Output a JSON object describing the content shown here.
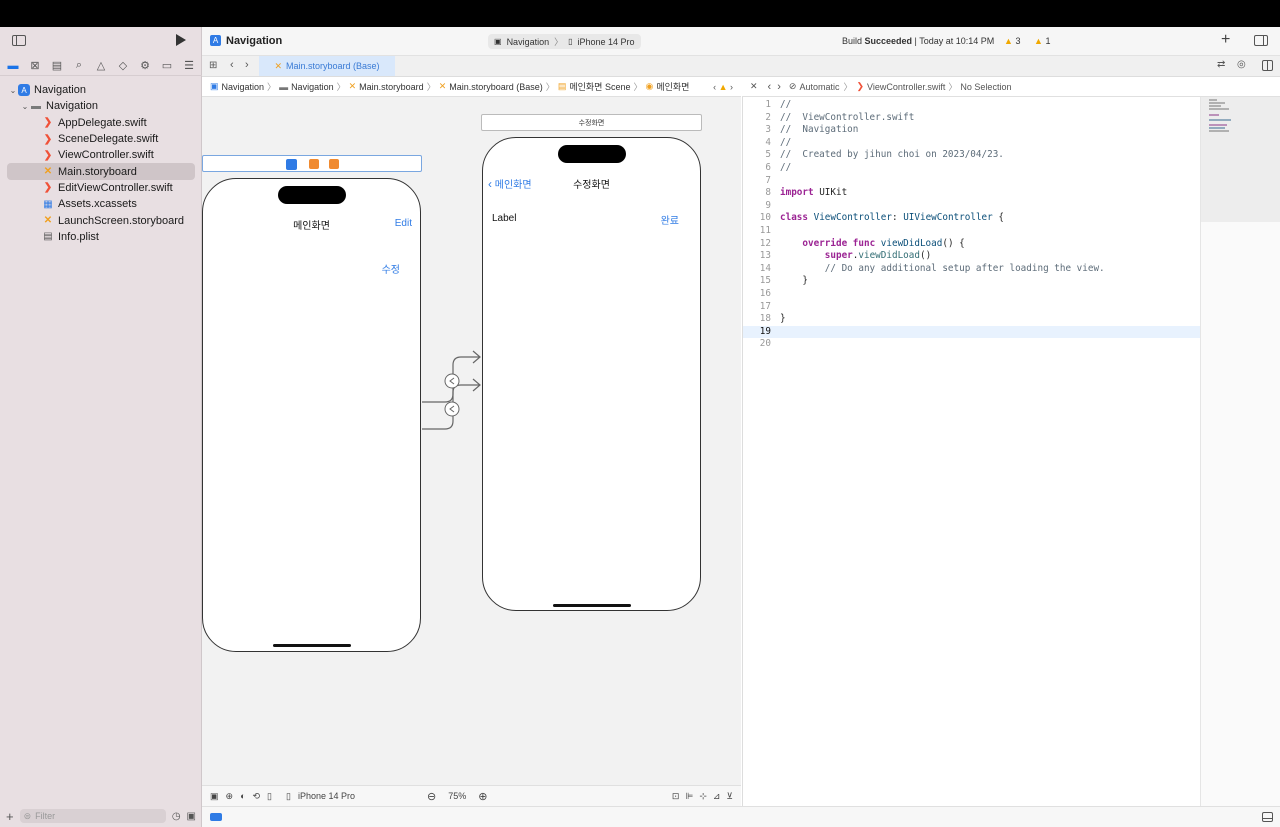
{
  "titlebar": {
    "project_name": "Navigation",
    "scheme": "Navigation",
    "device": "iPhone 14 Pro",
    "status_prefix": "Build ",
    "status_bold": "Succeeded",
    "status_time": " | Today at 10:14 PM",
    "warning_count": "3",
    "issue_count": "1"
  },
  "tab": {
    "label": "Main.storyboard (Base)"
  },
  "navigator": {
    "items": [
      {
        "label": "Navigation",
        "icon": "app-icon",
        "indent": 0,
        "disclosure": true
      },
      {
        "label": "Navigation",
        "icon": "folder-icon",
        "indent": 1,
        "disclosure": true
      },
      {
        "label": "AppDelegate.swift",
        "icon": "swift-icon",
        "indent": 2
      },
      {
        "label": "SceneDelegate.swift",
        "icon": "swift-icon",
        "indent": 2
      },
      {
        "label": "ViewController.swift",
        "icon": "swift-icon",
        "indent": 2
      },
      {
        "label": "Main.storyboard",
        "icon": "storyboard-icon",
        "indent": 2,
        "selected": true
      },
      {
        "label": "EditViewController.swift",
        "icon": "swift-icon",
        "indent": 2
      },
      {
        "label": "Assets.xcassets",
        "icon": "assets-icon",
        "indent": 2
      },
      {
        "label": "LaunchScreen.storyboard",
        "icon": "storyboard-icon",
        "indent": 2
      },
      {
        "label": "Info.plist",
        "icon": "plist-icon",
        "indent": 2
      }
    ],
    "filter_placeholder": "Filter"
  },
  "jumpbar_left": {
    "crumbs": [
      "Navigation",
      "Navigation",
      "Main.storyboard",
      "Main.storyboard (Base)",
      "메인화면 Scene",
      "메인화면"
    ]
  },
  "storyboard": {
    "main_scene": {
      "title": "메인화면",
      "right_button": "Edit",
      "edit_link": "수정"
    },
    "edit_scene": {
      "header": "수정화면",
      "title": "수정화면",
      "back_label": "메인화면",
      "label_text": "Label",
      "done_button": "완료"
    }
  },
  "canvas_bottom": {
    "device": "iPhone 14 Pro",
    "zoom": "75%"
  },
  "jumpbar_right": {
    "mode": "Automatic",
    "file": "ViewController.swift",
    "selection": "No Selection"
  },
  "code": {
    "current_line": 19,
    "lines": [
      [
        [
          "cm",
          "//"
        ]
      ],
      [
        [
          "cm",
          "//  ViewController.swift"
        ]
      ],
      [
        [
          "cm",
          "//  Navigation"
        ]
      ],
      [
        [
          "cm",
          "//"
        ]
      ],
      [
        [
          "cm",
          "//  Created by jihun choi on 2023/04/23."
        ]
      ],
      [
        [
          "cm",
          "//"
        ]
      ],
      [],
      [
        [
          "kw",
          "import"
        ],
        [
          "plain",
          " UIKit"
        ]
      ],
      [],
      [
        [
          "kw",
          "class"
        ],
        [
          "plain",
          " "
        ],
        [
          "ty",
          "ViewController"
        ],
        [
          "plain",
          ": "
        ],
        [
          "ty",
          "UIViewController"
        ],
        [
          "plain",
          " {"
        ]
      ],
      [],
      [
        [
          "plain",
          "    "
        ],
        [
          "kw",
          "override"
        ],
        [
          "plain",
          " "
        ],
        [
          "kw",
          "func"
        ],
        [
          "plain",
          " "
        ],
        [
          "ty",
          "viewDidLoad"
        ],
        [
          "plain",
          "() {"
        ]
      ],
      [
        [
          "plain",
          "        "
        ],
        [
          "kw",
          "super"
        ],
        [
          "plain",
          "."
        ],
        [
          "fn",
          "viewDidLoad"
        ],
        [
          "plain",
          "()"
        ]
      ],
      [
        [
          "plain",
          "        "
        ],
        [
          "cm",
          "// Do any additional setup after loading the view."
        ]
      ],
      [
        [
          "plain",
          "    }"
        ]
      ],
      [],
      [],
      [
        [
          "plain",
          "}"
        ]
      ],
      [],
      []
    ]
  }
}
